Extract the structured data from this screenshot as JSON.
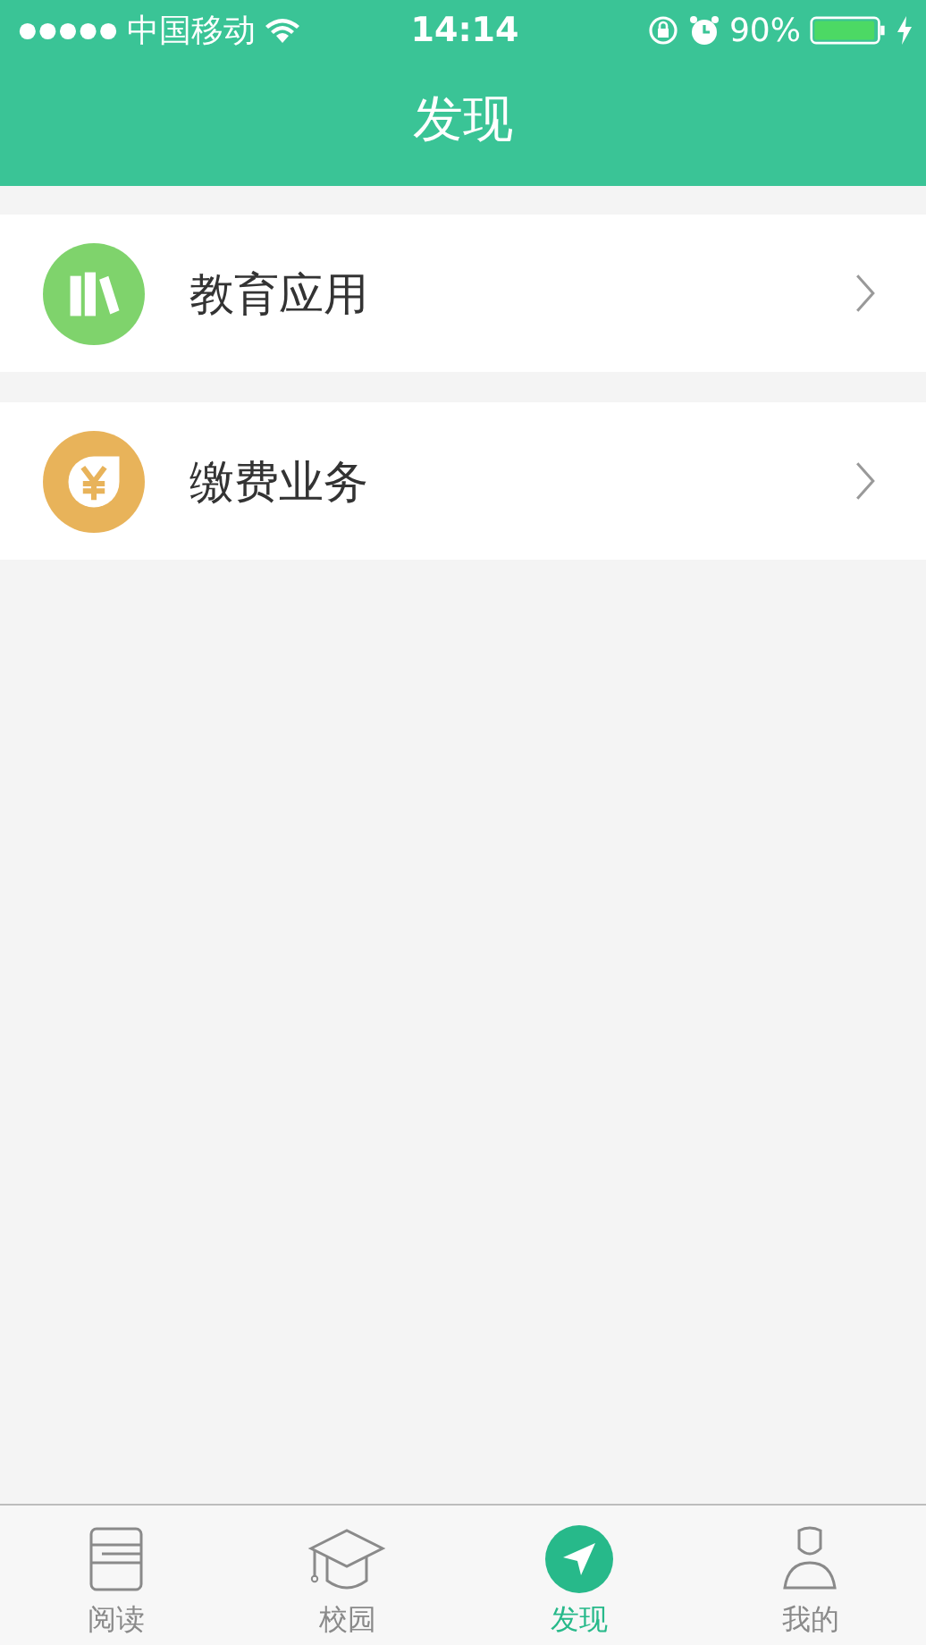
{
  "status_bar": {
    "carrier": "中国移动",
    "time": "14:14",
    "battery": "90%"
  },
  "header": {
    "title": "发现"
  },
  "items": [
    {
      "label": "教育应用",
      "kind": "books"
    },
    {
      "label": "缴费业务",
      "kind": "yen"
    }
  ],
  "tab_bar": [
    {
      "label": "阅读",
      "kind": "book",
      "selected": false
    },
    {
      "label": "校园",
      "kind": "cap",
      "selected": false
    },
    {
      "label": "发现",
      "kind": "compass",
      "selected": true
    },
    {
      "label": "我的",
      "kind": "person",
      "selected": false
    }
  ]
}
